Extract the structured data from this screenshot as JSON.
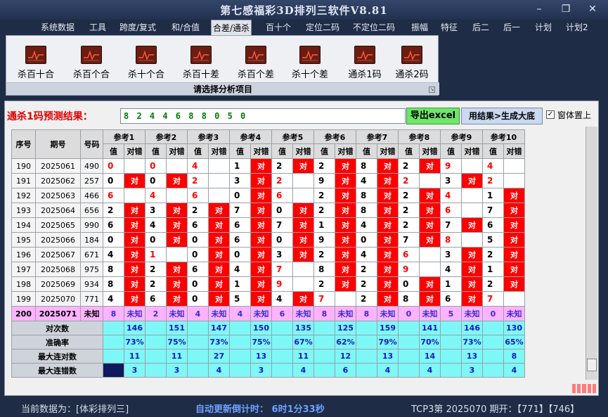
{
  "title": "第七感福彩3D排列三软件V8.81",
  "window_buttons": {
    "minimize": "–",
    "restore": "❐",
    "close": "✕"
  },
  "menu": [
    {
      "label": "系统数据",
      "active": false
    },
    {
      "label": "工具",
      "active": false
    },
    {
      "label": "跨度/复式",
      "active": false
    },
    {
      "label": "和/合值",
      "active": false
    },
    {
      "label": "合差/通杀",
      "active": true
    },
    {
      "label": "百十个",
      "active": false
    },
    {
      "label": "定位二码",
      "active": false
    },
    {
      "label": "不定位二码",
      "active": false
    },
    {
      "label": "振幅",
      "active": false
    },
    {
      "label": "特征",
      "active": false
    },
    {
      "label": "后二",
      "active": false
    },
    {
      "label": "后一",
      "active": false
    },
    {
      "label": "计划",
      "active": false
    },
    {
      "label": "计划2",
      "active": false
    }
  ],
  "ribbon": {
    "items": [
      {
        "label": "杀百十合",
        "icon": "chart-icon"
      },
      {
        "label": "杀百个合",
        "icon": "chart-icon"
      },
      {
        "label": "杀十个合",
        "icon": "chart-icon"
      },
      {
        "label": "杀百十差",
        "icon": "chart-icon"
      },
      {
        "label": "杀百个差",
        "icon": "chart-icon"
      },
      {
        "label": "杀十个差",
        "icon": "chart-icon"
      },
      {
        "label": "通杀1码",
        "icon": "chart-icon"
      },
      {
        "label": "通杀2码",
        "icon": "chart-icon"
      }
    ],
    "caption": "请选择分析项目"
  },
  "prediction": {
    "label": "通杀1码预测结果：",
    "value": "8 2 4 4 6 8 8 0 5 0"
  },
  "buttons": {
    "excel": "导出excel",
    "generate": "用结果>生成大底",
    "pin_label": "窗体置上",
    "pin_checked": true
  },
  "table": {
    "headers": {
      "seq": "序号",
      "period": "期号",
      "code": "号码",
      "value": "值",
      "check": "对错"
    },
    "groups": [
      "参考1",
      "参考2",
      "参考3",
      "参考4",
      "参考5",
      "参考6",
      "参考7",
      "参考8",
      "参考9",
      "参考10"
    ],
    "rows": [
      {
        "seq": "190",
        "period": "2025061",
        "code": "490",
        "cells": [
          [
            "0",
            "",
            true
          ],
          [
            "0",
            "",
            true
          ],
          [
            "4",
            "",
            true
          ],
          [
            "1",
            "对",
            false
          ],
          [
            "2",
            "对",
            false
          ],
          [
            "2",
            "对",
            false
          ],
          [
            "8",
            "对",
            false
          ],
          [
            "2",
            "对",
            false
          ],
          [
            "9",
            "",
            true
          ],
          [
            "4",
            "",
            true
          ]
        ]
      },
      {
        "seq": "191",
        "period": "2025062",
        "code": "257",
        "cells": [
          [
            "0",
            "对",
            false
          ],
          [
            "0",
            "对",
            false
          ],
          [
            "2",
            "",
            true
          ],
          [
            "3",
            "对",
            false
          ],
          [
            "2",
            "",
            true
          ],
          [
            "9",
            "对",
            false
          ],
          [
            "4",
            "对",
            false
          ],
          [
            "2",
            "",
            true
          ],
          [
            "3",
            "对",
            false
          ],
          [
            "2",
            "",
            true
          ]
        ]
      },
      {
        "seq": "192",
        "period": "2025063",
        "code": "466",
        "cells": [
          [
            "6",
            "",
            true
          ],
          [
            "4",
            "",
            true
          ],
          [
            "6",
            "",
            true
          ],
          [
            "0",
            "对",
            false
          ],
          [
            "6",
            "",
            true
          ],
          [
            "2",
            "对",
            false
          ],
          [
            "8",
            "对",
            false
          ],
          [
            "2",
            "对",
            false
          ],
          [
            "4",
            "",
            true
          ],
          [
            "1",
            "对",
            false
          ]
        ]
      },
      {
        "seq": "193",
        "period": "2025064",
        "code": "656",
        "cells": [
          [
            "2",
            "对",
            false
          ],
          [
            "3",
            "对",
            false
          ],
          [
            "2",
            "对",
            false
          ],
          [
            "7",
            "对",
            false
          ],
          [
            "0",
            "对",
            false
          ],
          [
            "2",
            "对",
            false
          ],
          [
            "8",
            "对",
            false
          ],
          [
            "2",
            "对",
            false
          ],
          [
            "6",
            "",
            true
          ],
          [
            "7",
            "对",
            false
          ]
        ]
      },
      {
        "seq": "194",
        "period": "2025065",
        "code": "990",
        "cells": [
          [
            "6",
            "对",
            false
          ],
          [
            "4",
            "对",
            false
          ],
          [
            "6",
            "对",
            false
          ],
          [
            "6",
            "对",
            false
          ],
          [
            "7",
            "对",
            false
          ],
          [
            "1",
            "对",
            false
          ],
          [
            "4",
            "对",
            false
          ],
          [
            "2",
            "对",
            false
          ],
          [
            "7",
            "对",
            false
          ],
          [
            "6",
            "对",
            false
          ]
        ]
      },
      {
        "seq": "195",
        "period": "2025066",
        "code": "184",
        "cells": [
          [
            "0",
            "对",
            false
          ],
          [
            "0",
            "对",
            false
          ],
          [
            "0",
            "对",
            false
          ],
          [
            "6",
            "对",
            false
          ],
          [
            "0",
            "对",
            false
          ],
          [
            "9",
            "对",
            false
          ],
          [
            "0",
            "对",
            false
          ],
          [
            "7",
            "对",
            false
          ],
          [
            "8",
            "",
            true
          ],
          [
            "5",
            "对",
            false
          ]
        ]
      },
      {
        "seq": "196",
        "period": "2025067",
        "code": "671",
        "cells": [
          [
            "4",
            "对",
            false
          ],
          [
            "1",
            "",
            true
          ],
          [
            "0",
            "对",
            false
          ],
          [
            "0",
            "对",
            false
          ],
          [
            "3",
            "对",
            false
          ],
          [
            "2",
            "对",
            false
          ],
          [
            "4",
            "对",
            false
          ],
          [
            "6",
            "",
            true
          ],
          [
            "3",
            "对",
            false
          ],
          [
            "2",
            "对",
            false
          ]
        ]
      },
      {
        "seq": "197",
        "period": "2025068",
        "code": "975",
        "cells": [
          [
            "8",
            "对",
            false
          ],
          [
            "2",
            "对",
            false
          ],
          [
            "6",
            "对",
            false
          ],
          [
            "4",
            "对",
            false
          ],
          [
            "7",
            "",
            true
          ],
          [
            "8",
            "对",
            false
          ],
          [
            "2",
            "对",
            false
          ],
          [
            "9",
            "",
            true
          ],
          [
            "4",
            "对",
            false
          ],
          [
            "1",
            "对",
            false
          ]
        ]
      },
      {
        "seq": "198",
        "period": "2025069",
        "code": "934",
        "cells": [
          [
            "8",
            "对",
            false
          ],
          [
            "2",
            "对",
            false
          ],
          [
            "0",
            "对",
            false
          ],
          [
            "1",
            "对",
            false
          ],
          [
            "9",
            "",
            true
          ],
          [
            "2",
            "对",
            false
          ],
          [
            "2",
            "对",
            false
          ],
          [
            "0",
            "对",
            false
          ],
          [
            "1",
            "对",
            false
          ],
          [
            "2",
            "对",
            false
          ]
        ]
      },
      {
        "seq": "199",
        "period": "2025070",
        "code": "771",
        "cells": [
          [
            "4",
            "对",
            false
          ],
          [
            "6",
            "对",
            false
          ],
          [
            "0",
            "对",
            false
          ],
          [
            "5",
            "对",
            false
          ],
          [
            "4",
            "对",
            false
          ],
          [
            "7",
            "",
            true
          ],
          [
            "2",
            "对",
            false
          ],
          [
            "8",
            "对",
            false
          ],
          [
            "6",
            "对",
            false
          ],
          [
            "7",
            "",
            true
          ]
        ]
      }
    ],
    "pred_row": {
      "seq": "200",
      "period": "2025071",
      "code": "未知",
      "cells": [
        [
          "8",
          "未知"
        ],
        [
          "2",
          "未知"
        ],
        [
          "4",
          "未知"
        ],
        [
          "4",
          "未知"
        ],
        [
          "6",
          "未知"
        ],
        [
          "8",
          "未知"
        ],
        [
          "8",
          "未知"
        ],
        [
          "0",
          "未知"
        ],
        [
          "5",
          "未知"
        ],
        [
          "0",
          "未知"
        ]
      ]
    },
    "stats": [
      {
        "label": "对次数",
        "values": [
          "146",
          "151",
          "147",
          "150",
          "135",
          "125",
          "159",
          "141",
          "146",
          "130"
        ]
      },
      {
        "label": "准确率",
        "values": [
          "73%",
          "75%",
          "73%",
          "75%",
          "67%",
          "62%",
          "79%",
          "70%",
          "73%",
          "65%"
        ]
      },
      {
        "label": "最大连对数",
        "values": [
          "11",
          "11",
          "27",
          "13",
          "11",
          "12",
          "13",
          "14",
          "13",
          "8"
        ]
      },
      {
        "label": "最大连错数",
        "values": [
          "3",
          "3",
          "4",
          "3",
          "4",
          "6",
          "4",
          "4",
          "3",
          "4"
        ]
      }
    ]
  },
  "status": {
    "current": "当前数据为：[体彩排列三]",
    "countdown": "自动更新倒计时： 6时1分33秒",
    "issue": "TCP3第 2025070 期开：【771】【746】"
  },
  "colors": {
    "hit": "#ff0000",
    "accent": "#7ef7f7",
    "predict_row": "#ffb3ff",
    "prediction_text": "#007a00"
  }
}
